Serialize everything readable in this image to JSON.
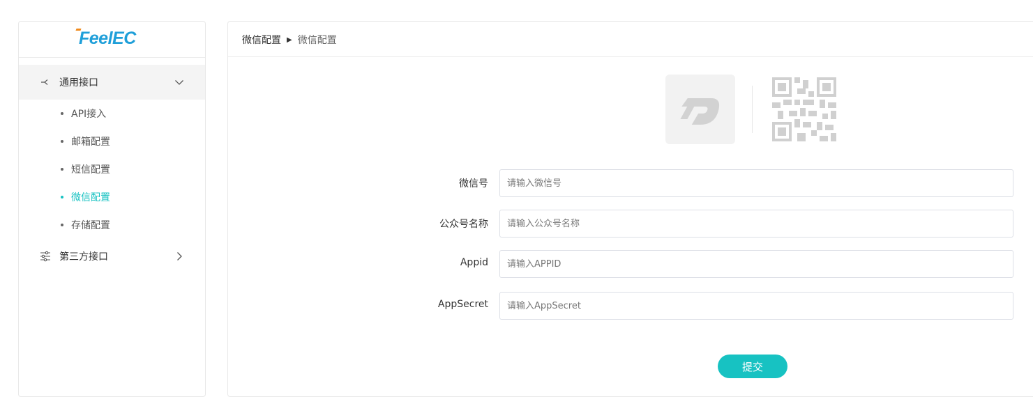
{
  "brand": {
    "logo_text": "FeelEC",
    "color": "#1f9fd9",
    "accent": "#f08a1c"
  },
  "sidebar": {
    "groups": [
      {
        "label": "通用接口",
        "icon": "api-branch-icon",
        "expanded": true,
        "items": [
          {
            "label": "API接入",
            "active": false
          },
          {
            "label": "邮箱配置",
            "active": false
          },
          {
            "label": "短信配置",
            "active": false
          },
          {
            "label": "微信配置",
            "active": true
          },
          {
            "label": "存储配置",
            "active": false
          }
        ]
      },
      {
        "label": "第三方接口",
        "icon": "sliders-icon",
        "expanded": false
      }
    ],
    "active_color": "#17c2c2"
  },
  "breadcrumb": {
    "parent": "微信配置",
    "separator": "▶",
    "current": "微信配置"
  },
  "form": {
    "fields": [
      {
        "label": "微信号",
        "placeholder": "请输入微信号",
        "value": ""
      },
      {
        "label": "公众号名称",
        "placeholder": "请输入公众号名称",
        "value": ""
      },
      {
        "label": "Appid",
        "placeholder": "请输入APPID",
        "value": ""
      },
      {
        "label": "AppSecret",
        "placeholder": "请输入AppSecret",
        "value": ""
      }
    ],
    "submit_label": "提交"
  }
}
